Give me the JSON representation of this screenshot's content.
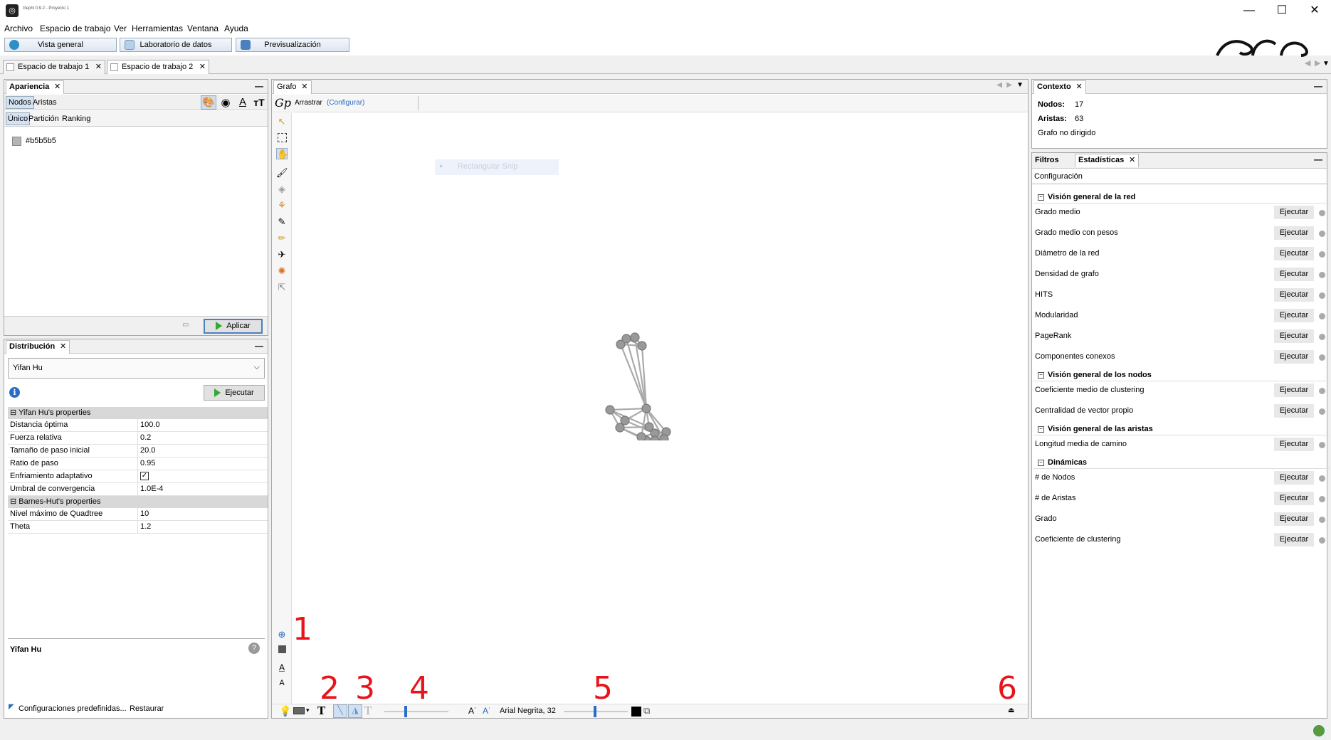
{
  "window": {
    "title": "Gephi 0.9.2 - Proyecto 1",
    "minimize_glyph": "—",
    "maximize_glyph": "☐",
    "close_glyph": "✕"
  },
  "menu": [
    "Archivo",
    "Espacio de trabajo",
    "Ver",
    "Herramientas",
    "Ventana",
    "Ayuda"
  ],
  "modes": [
    {
      "label": "Vista general",
      "color": "#2d8fc4"
    },
    {
      "label": "Laboratorio de datos",
      "color": "#6e98c7"
    },
    {
      "label": "Previsualización",
      "color": "#4a7fc0"
    }
  ],
  "workspaces": [
    "Espacio de trabajo 1",
    "Espacio de trabajo 2"
  ],
  "appearance": {
    "title": "Apariencia",
    "tabs": [
      "Nodos",
      "Aristas"
    ],
    "subtabs": [
      "Único",
      "Partición",
      "Ranking"
    ],
    "color_value": "#b5b5b5",
    "apply_label": "Aplicar"
  },
  "layout": {
    "title": "Distribución",
    "algorithm": "Yifan Hu",
    "run_label": "Ejecutar",
    "groups": [
      {
        "name": "Yifan Hu's properties",
        "props": [
          {
            "k": "Distancia óptima",
            "v": "100.0"
          },
          {
            "k": "Fuerza relativa",
            "v": "0.2"
          },
          {
            "k": "Tamaño de paso inicial",
            "v": "20.0"
          },
          {
            "k": "Ratio de paso",
            "v": "0.95"
          },
          {
            "k": "Enfriamiento adaptativo",
            "v": ""
          },
          {
            "k": "Umbral de convergencia",
            "v": "1.0E-4"
          }
        ]
      },
      {
        "name": "Barnes-Hut's properties",
        "props": [
          {
            "k": "Nivel máximo de Quadtree",
            "v": "10"
          },
          {
            "k": "Theta",
            "v": "1.2"
          }
        ]
      }
    ],
    "description_title": "Yifan Hu",
    "presets_label": "Configuraciones predefinidas...",
    "restore_label": "Restaurar"
  },
  "graph": {
    "title": "Grafo",
    "drag_label": "Arrastrar",
    "configure_label": "(Configurar)",
    "ghost_label": "Rectangular Snip",
    "font_label": "Arial Negrita, 32",
    "numbers": [
      "1",
      "2",
      "3",
      "4",
      "5",
      "6"
    ]
  },
  "context": {
    "title": "Contexto",
    "nodes_label": "Nodos:",
    "nodes_value": "17",
    "edges_label": "Aristas:",
    "edges_value": "63",
    "graph_type": "Grafo no dirigido"
  },
  "statistics": {
    "tabs": [
      "Filtros",
      "Estadísticas"
    ],
    "config_label": "Configuración",
    "run_label": "Ejecutar",
    "groups": [
      {
        "name": "Visión general de la red",
        "items": [
          "Grado medio",
          "Grado medio con pesos",
          "Diámetro de la red",
          "Densidad de grafo",
          "HITS",
          "Modularidad",
          "PageRank",
          "Componentes conexos"
        ]
      },
      {
        "name": "Visión general de los nodos",
        "items": [
          "Coeficiente medio de clustering",
          "Centralidad de vector propio"
        ]
      },
      {
        "name": "Visión general de las aristas",
        "items": [
          "Longitud media de camino"
        ]
      },
      {
        "name": "Dinámicas",
        "items": [
          "# de Nodos",
          "# de Aristas",
          "Grado",
          "Coeficiente de clustering"
        ]
      }
    ]
  }
}
